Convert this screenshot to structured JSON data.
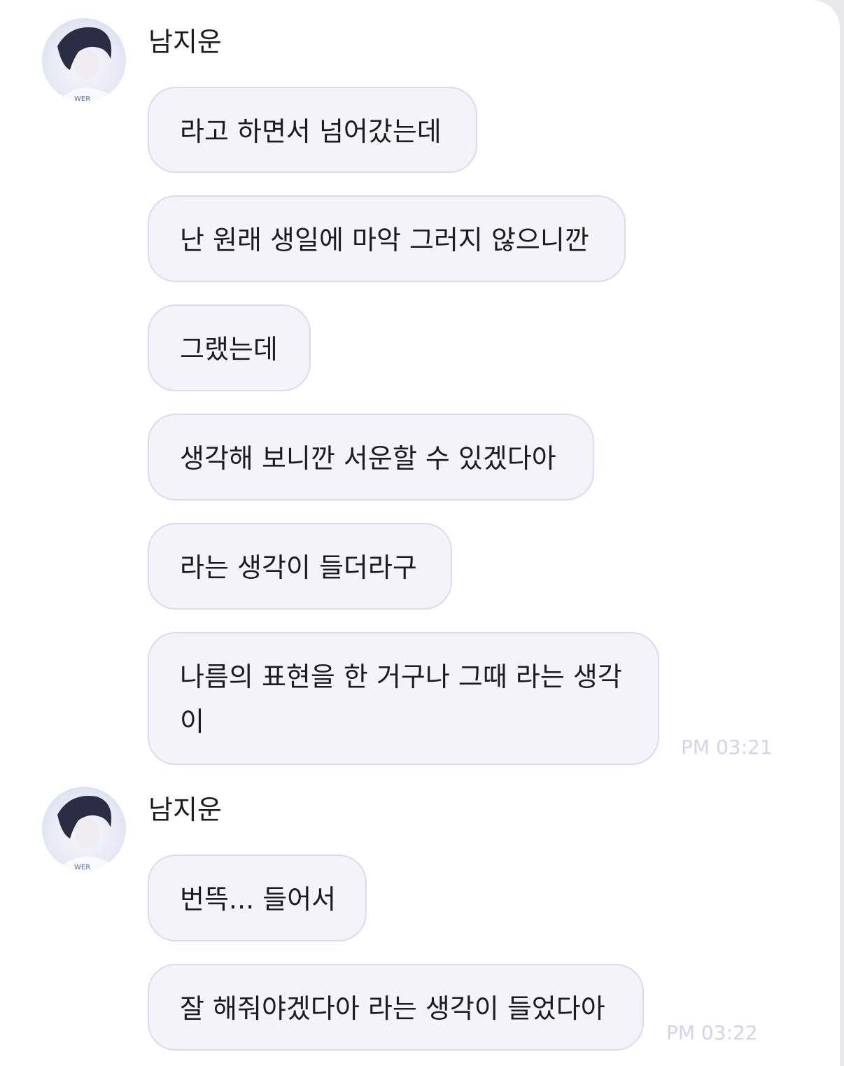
{
  "groups": [
    {
      "sender": "남지운",
      "messages": [
        "라고 하면서 넘어갔는데",
        "난 원래 생일에 마악 그러지 않으니깐",
        "그랬는데",
        "생각해 보니깐 서운할 수 있겠다아",
        "라는 생각이 들더라구",
        "나름의 표현을 한 거구나 그때 라는 생각이"
      ],
      "time": "PM 03:21"
    },
    {
      "sender": "남지운",
      "messages": [
        "번뜩... 들어서",
        "잘 해줘야겠다아 라는 생각이 들었다아"
      ],
      "time": "PM 03:22"
    }
  ],
  "colors": {
    "bubble_bg": "#f4f3fa",
    "bubble_border": "#ddd8f6",
    "timestamp": "#d4d2ef",
    "text": "#1c1c1e"
  }
}
